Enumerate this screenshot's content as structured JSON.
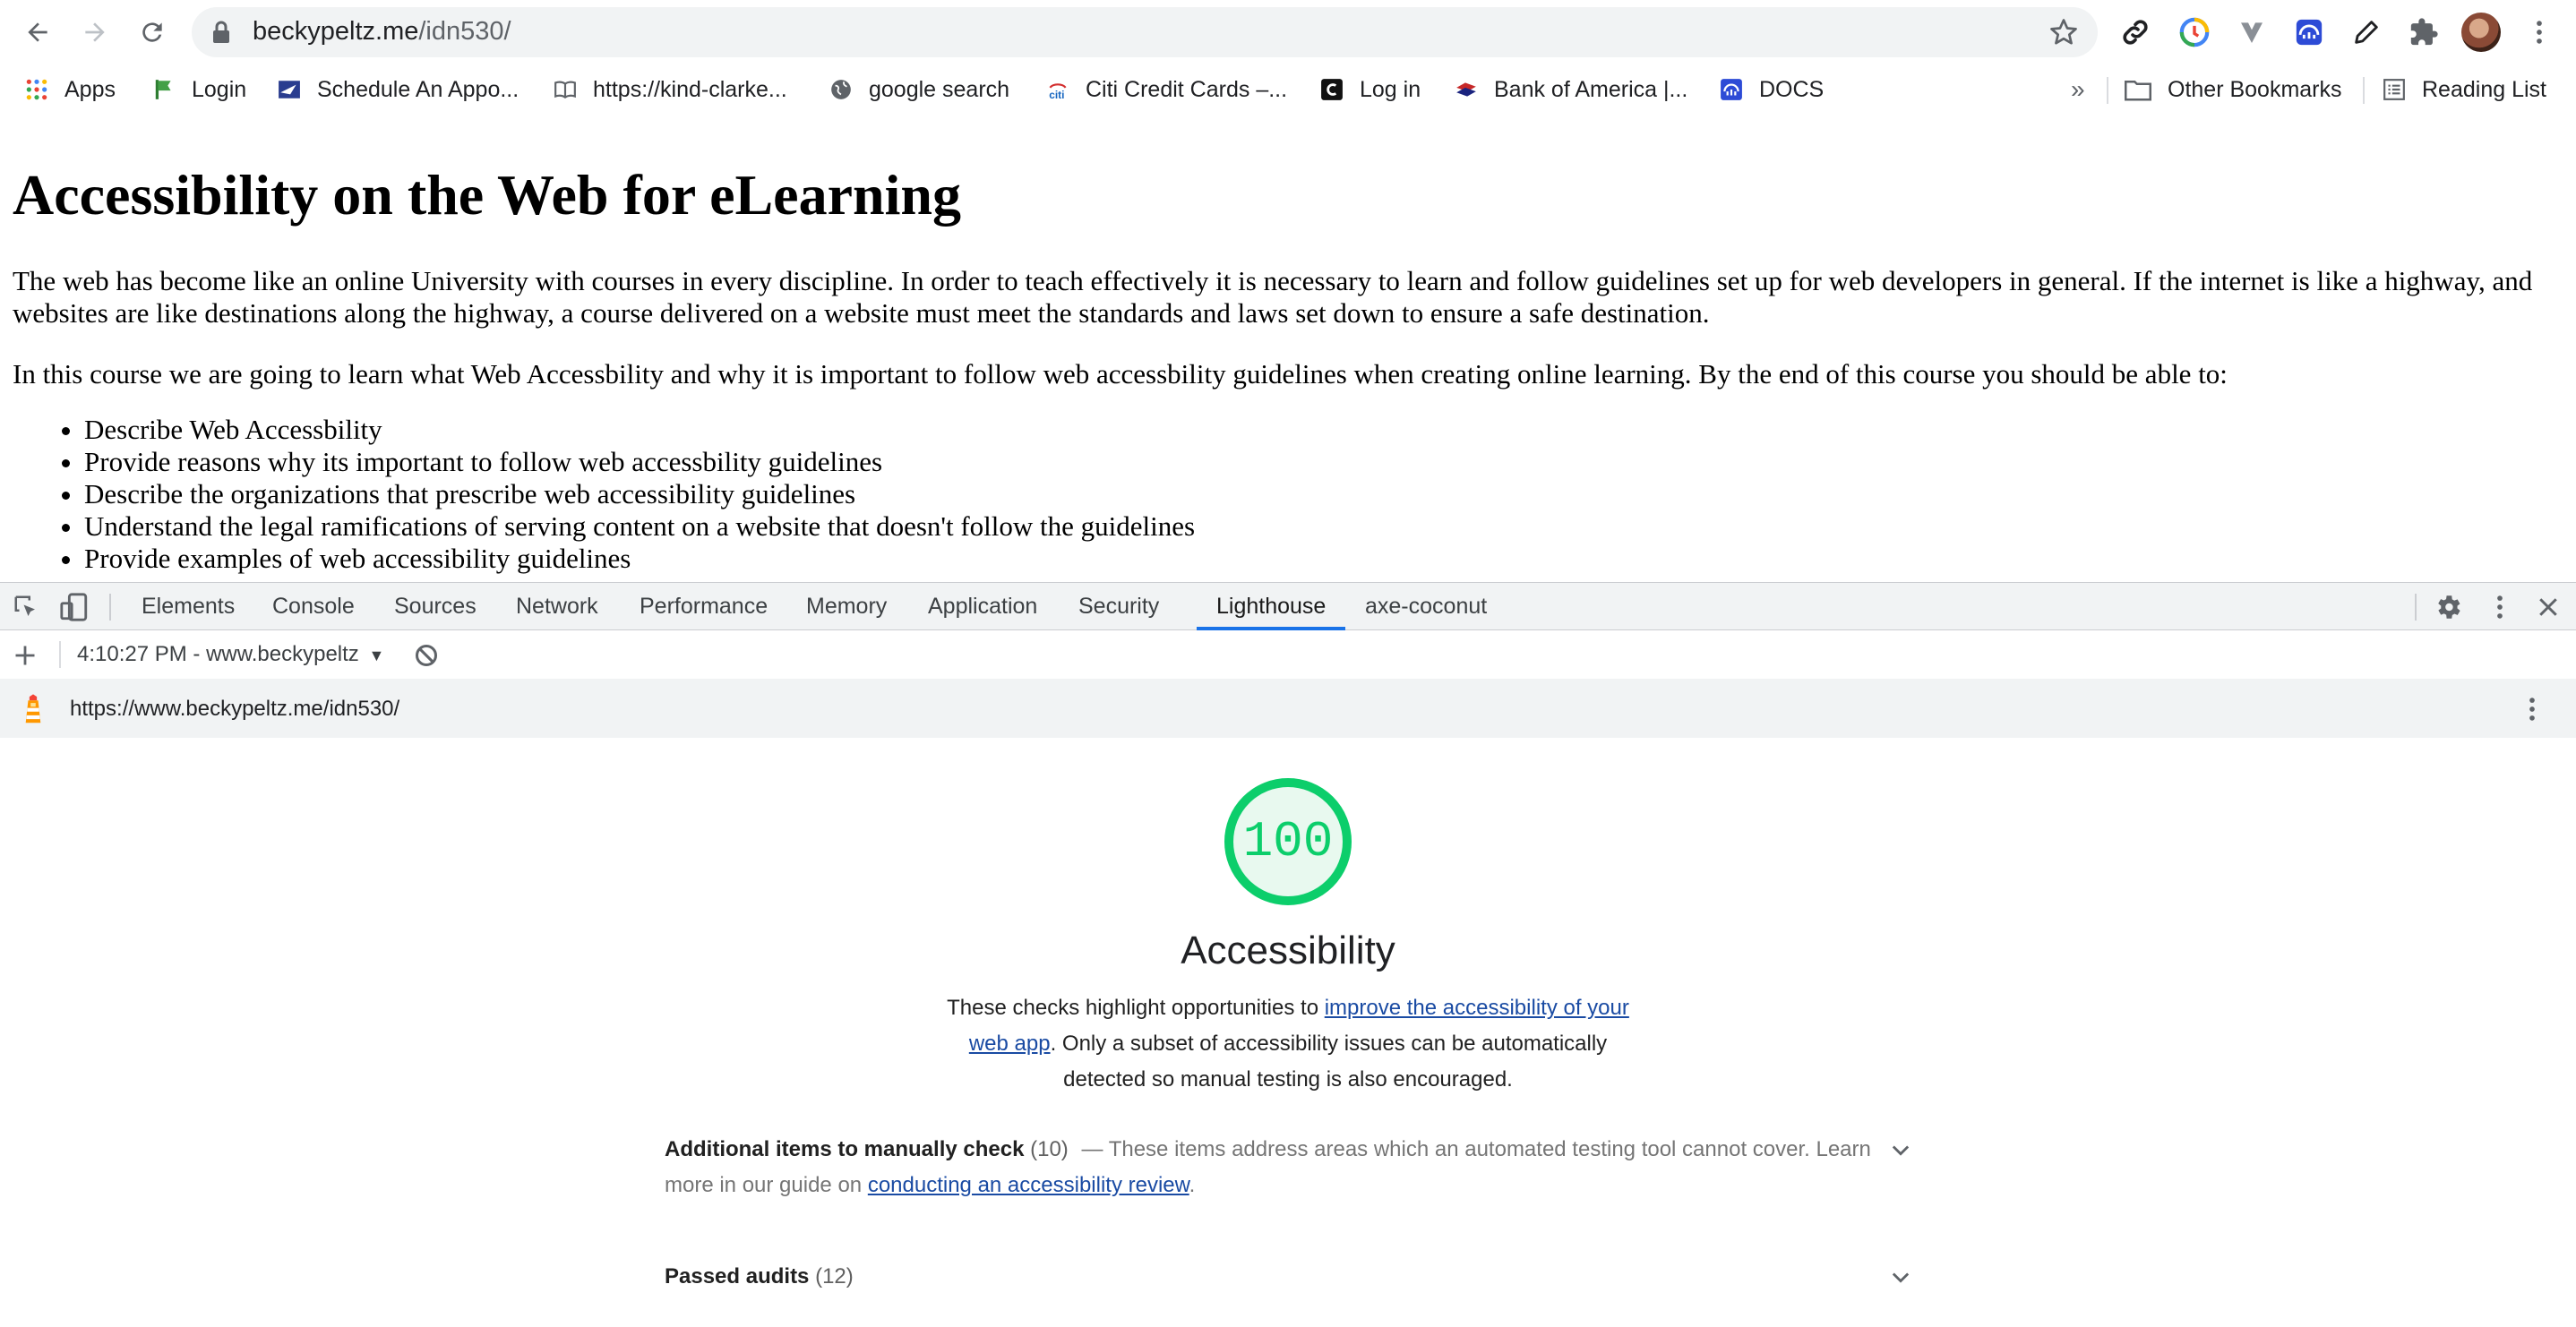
{
  "browser": {
    "url_host": "beckypeltz.me",
    "url_path": "/idn530/",
    "extensions": [
      "link-icon",
      "chromatic-icon",
      "vuetify-icon",
      "docs-extension-icon",
      "pencil-icon",
      "puzzle-icon"
    ]
  },
  "bookmarks": {
    "items": [
      {
        "label": "Apps",
        "icon": "apps-grid-icon"
      },
      {
        "label": "Login",
        "icon": "green-flag-icon"
      },
      {
        "label": "Schedule An Appo...",
        "icon": "usps-eagle-icon"
      },
      {
        "label": "https://kind-clarke...",
        "icon": "book-icon"
      },
      {
        "label": "google search",
        "icon": "globe-icon"
      },
      {
        "label": "Citi Credit Cards –...",
        "icon": "citi-icon"
      },
      {
        "label": "Log in",
        "icon": "c-logo-icon"
      },
      {
        "label": "Bank of America |...",
        "icon": "bofa-flag-icon"
      },
      {
        "label": "DOCS",
        "icon": "docs-house-icon"
      }
    ],
    "overflow": "»",
    "other": "Other Bookmarks",
    "reading_list": "Reading List"
  },
  "page": {
    "title": "Accessibility on the Web for eLearning",
    "para1": "The web has become like an online University with courses in every discipline. In order to teach effectively it is necessary to learn and follow guidelines set up for web developers in general. If the internet is like a highway, and websites are like destinations along the highway, a course delivered on a website must meet the standards and laws set down to ensure a safe destination.",
    "para2": "In this course we are going to learn what Web Accessbility and why it is important to follow web accessbility guidelines when creating online learning. By the end of this course you should be able to:",
    "objectives": [
      "Describe Web Accessbility",
      "Provide reasons why its important to follow web accessbility guidelines",
      "Describe the organizations that prescribe web accessibility guidelines",
      "Understand the legal ramifications of serving content on a website that doesn't follow the guidelines",
      "Provide examples of web accessibility guidelines"
    ]
  },
  "devtools": {
    "tabs": [
      "Elements",
      "Console",
      "Sources",
      "Network",
      "Performance",
      "Memory",
      "Application",
      "Security",
      "Lighthouse",
      "axe-coconut"
    ],
    "active_tab": "Lighthouse",
    "report_selector": "4:10:27 PM - www.beckypeltz",
    "report_url": "https://www.beckypeltz.me/idn530/"
  },
  "lighthouse": {
    "score": "100",
    "score_fraction": 1.0,
    "score_color": "#0cce6b",
    "category_title": "Accessibility",
    "description_before": "These checks highlight opportunities to ",
    "description_link": "improve the accessibility of your web app",
    "description_after": ". Only a subset of accessibility issues can be automatically detected so manual testing is also encouraged.",
    "manual_title": "Additional items to manually check",
    "manual_count": "(10)",
    "manual_desc": "— These items address areas which an automated testing tool cannot cover. Learn more in our guide on ",
    "manual_link": "conducting an accessibility review",
    "manual_end": ".",
    "passed_title": "Passed audits",
    "passed_count": "(12)"
  }
}
